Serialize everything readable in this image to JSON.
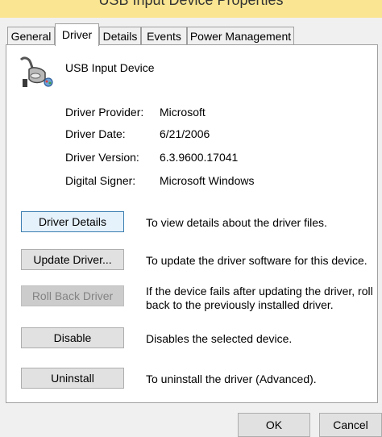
{
  "window": {
    "title": "USB Input Device Properties"
  },
  "tabs": [
    {
      "label": "General",
      "active": false
    },
    {
      "label": "Driver",
      "active": true
    },
    {
      "label": "Details",
      "active": false
    },
    {
      "label": "Events",
      "active": false
    },
    {
      "label": "Power Management",
      "active": false
    }
  ],
  "device": {
    "name": "USB Input Device",
    "icon": "game-controller-icon"
  },
  "properties": [
    {
      "label": "Driver Provider:",
      "value": "Microsoft"
    },
    {
      "label": "Driver Date:",
      "value": "6/21/2006"
    },
    {
      "label": "Driver Version:",
      "value": "6.3.9600.17041"
    },
    {
      "label": "Digital Signer:",
      "value": "Microsoft Windows"
    }
  ],
  "actions": [
    {
      "label": "Driver Details",
      "description": "To view details about the driver files.",
      "enabled": true
    },
    {
      "label": "Update Driver...",
      "description": "To update the driver software for this device.",
      "enabled": true
    },
    {
      "label": "Roll Back Driver",
      "description_lines": [
        "If the device fails after updating the driver, roll",
        "back to the previously installed driver."
      ],
      "enabled": false
    },
    {
      "label": "Disable",
      "description": "Disables the selected device.",
      "enabled": true
    },
    {
      "label": "Uninstall",
      "description": "To uninstall the driver (Advanced).",
      "enabled": true
    }
  ],
  "footer": {
    "ok_label": "OK",
    "cancel_label": "Cancel"
  },
  "colors": {
    "titlebar": "#f9e592",
    "panel": "#ffffff",
    "window": "#f0f0f0",
    "focus_border": "#3c7fb1"
  }
}
